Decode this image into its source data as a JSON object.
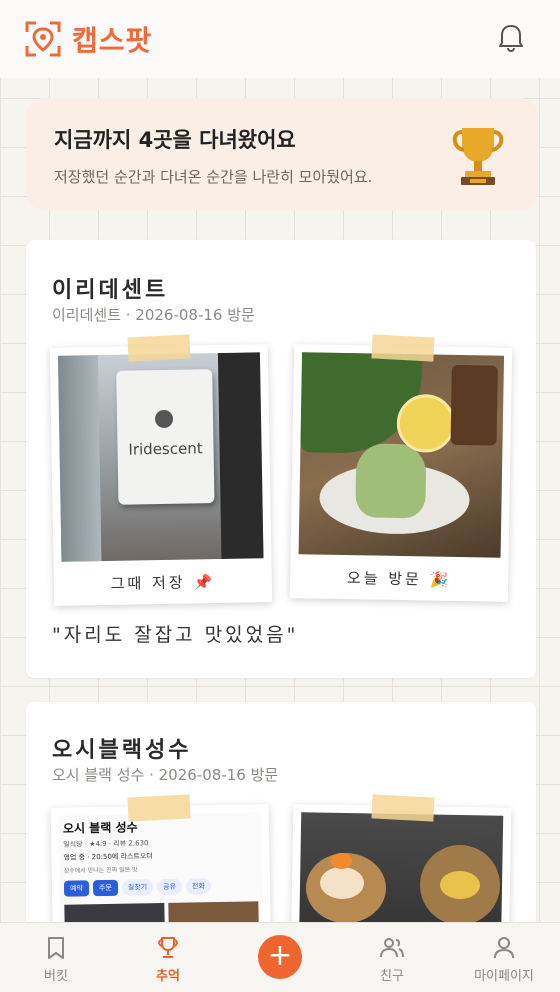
{
  "app": {
    "name": "캡스팟"
  },
  "banner": {
    "title": "지금까지 4곳을 다녀왔어요",
    "subtitle": "저장했던 순간과 다녀온 순간을 나란히 모아뒀어요."
  },
  "cards": [
    {
      "title": "이리데센트",
      "subtitle": "이리데센트 · 2026-08-16 방문",
      "photos": [
        {
          "caption": "그때 저장",
          "emoji": "📌",
          "sign_text": "Iridescent"
        },
        {
          "caption": "오늘 방문",
          "emoji": "🎉"
        }
      ],
      "quote": "\"자리도 잘잡고 맛있었음\""
    },
    {
      "title": "오시블랙성수",
      "subtitle": "오시 블랙 성수 · 2026-08-16 방문",
      "listing": {
        "name": "오시 블랙 성수",
        "category_rating": "일식당 · ★4.9 · 리뷰 2,630",
        "hours": "영업 중 · 20:50에 라스트오더",
        "note": "성수에서 만나는 진짜 일본 맛",
        "buttons": [
          "예약",
          "주문",
          "길찾기",
          "공유",
          "전화"
        ]
      }
    }
  ],
  "tabbar": {
    "items": [
      {
        "label": "버킷",
        "icon": "bookmark-icon"
      },
      {
        "label": "추억",
        "icon": "trophy-icon",
        "active": true
      },
      {
        "label": "+",
        "icon": "plus-icon"
      },
      {
        "label": "친구",
        "icon": "friends-icon"
      },
      {
        "label": "마이페이지",
        "icon": "person-icon"
      }
    ]
  },
  "colors": {
    "accent": "#ef6530",
    "banner_bg": "#fbeee5",
    "tape": "#f6d696"
  }
}
